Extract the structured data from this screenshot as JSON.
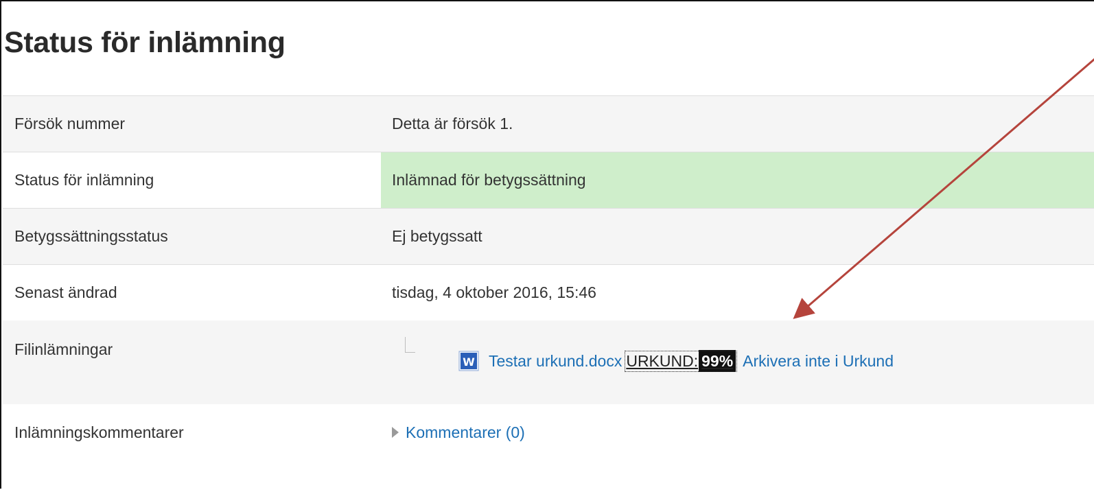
{
  "page": {
    "title": "Status för inlämning"
  },
  "rows": [
    {
      "label": "Försök nummer",
      "value": "Detta är försök 1."
    },
    {
      "label": "Status för inlämning",
      "value": "Inlämnad för betygssättning"
    },
    {
      "label": "Betygssättningsstatus",
      "value": "Ej betygssatt"
    },
    {
      "label": "Senast ändrad",
      "value": "tisdag, 4 oktober 2016, 15:46"
    }
  ],
  "files": {
    "label": "Filinlämningar",
    "icon": "word-document-icon",
    "file_name": "Testar urkund.docx",
    "urkund_label": "URKUND:",
    "urkund_score": "99%",
    "archive_link": "Arkivera inte i Urkund"
  },
  "comments": {
    "label": "Inlämningskommentarer",
    "link": "Kommentarer (0)"
  },
  "colors": {
    "submitted_bg": "#cfeecb",
    "link": "#1c6fb5",
    "annotation_arrow": "#b5443c",
    "score_badge_bg": "#111111"
  }
}
